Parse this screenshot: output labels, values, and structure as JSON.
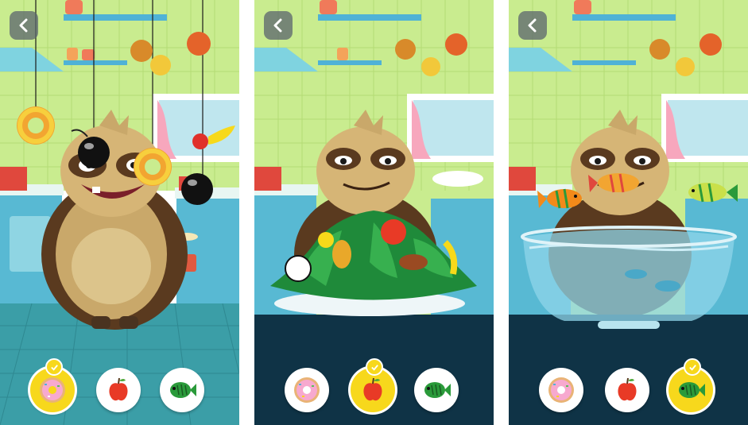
{
  "screens": [
    {
      "id": "play",
      "selected_food": "donut"
    },
    {
      "id": "salad",
      "selected_food": "apple"
    },
    {
      "id": "aquarium",
      "selected_food": "fish"
    }
  ],
  "food_options": [
    "donut",
    "apple",
    "fish"
  ],
  "icons": {
    "back": "chevron-left-icon",
    "donut": "donut-icon",
    "apple": "apple-icon",
    "fish": "fish-icon",
    "check": "checkmark-icon"
  },
  "colors": {
    "wall": "#c9ec8f",
    "kitchen_floor": "#3b9ea7",
    "dark_floor": "#0f3346",
    "selected_button": "#f7d81c",
    "button": "#ffffff"
  }
}
